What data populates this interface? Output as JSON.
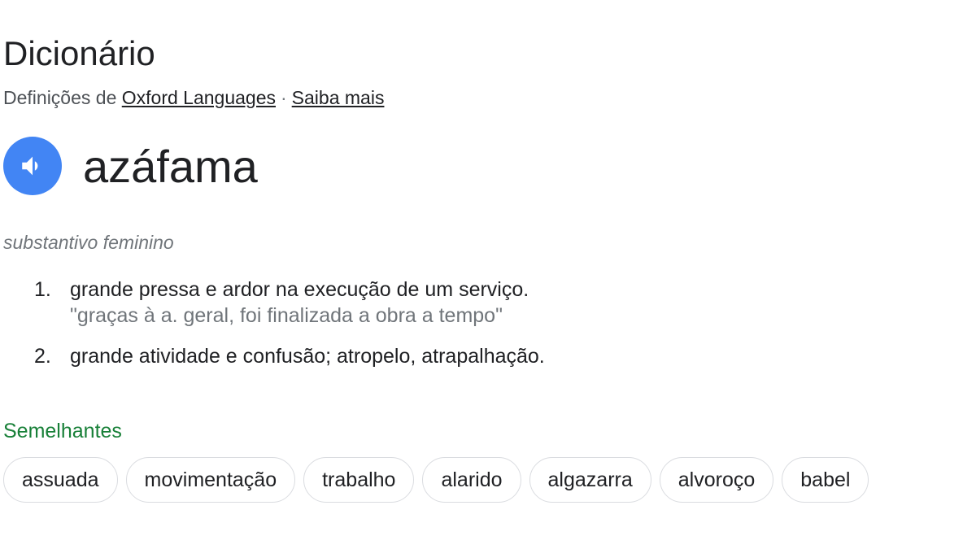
{
  "header": {
    "title": "Dicionário",
    "source_prefix": "Definições de",
    "source_link": "Oxford Languages",
    "separator": "·",
    "learn_more": "Saiba mais"
  },
  "entry": {
    "word": "azáfama",
    "speaker_icon": "speaker-icon",
    "part_of_speech": "substantivo feminino",
    "definitions": [
      {
        "number": "1.",
        "text": "grande pressa e ardor na execução de um serviço.",
        "example": "\"graças à a. geral, foi finalizada a obra a tempo\""
      },
      {
        "number": "2.",
        "text": "grande atividade e confusão; atropelo, atrapalhação.",
        "example": ""
      }
    ]
  },
  "similar": {
    "label": "Semelhantes",
    "chips": [
      "assuada",
      "movimentação",
      "trabalho",
      "alarido",
      "algazarra",
      "alvoroço",
      "babel"
    ]
  },
  "colors": {
    "speaker_bg": "#4285f4",
    "similar_label": "#188038",
    "secondary_text": "#70757a"
  }
}
